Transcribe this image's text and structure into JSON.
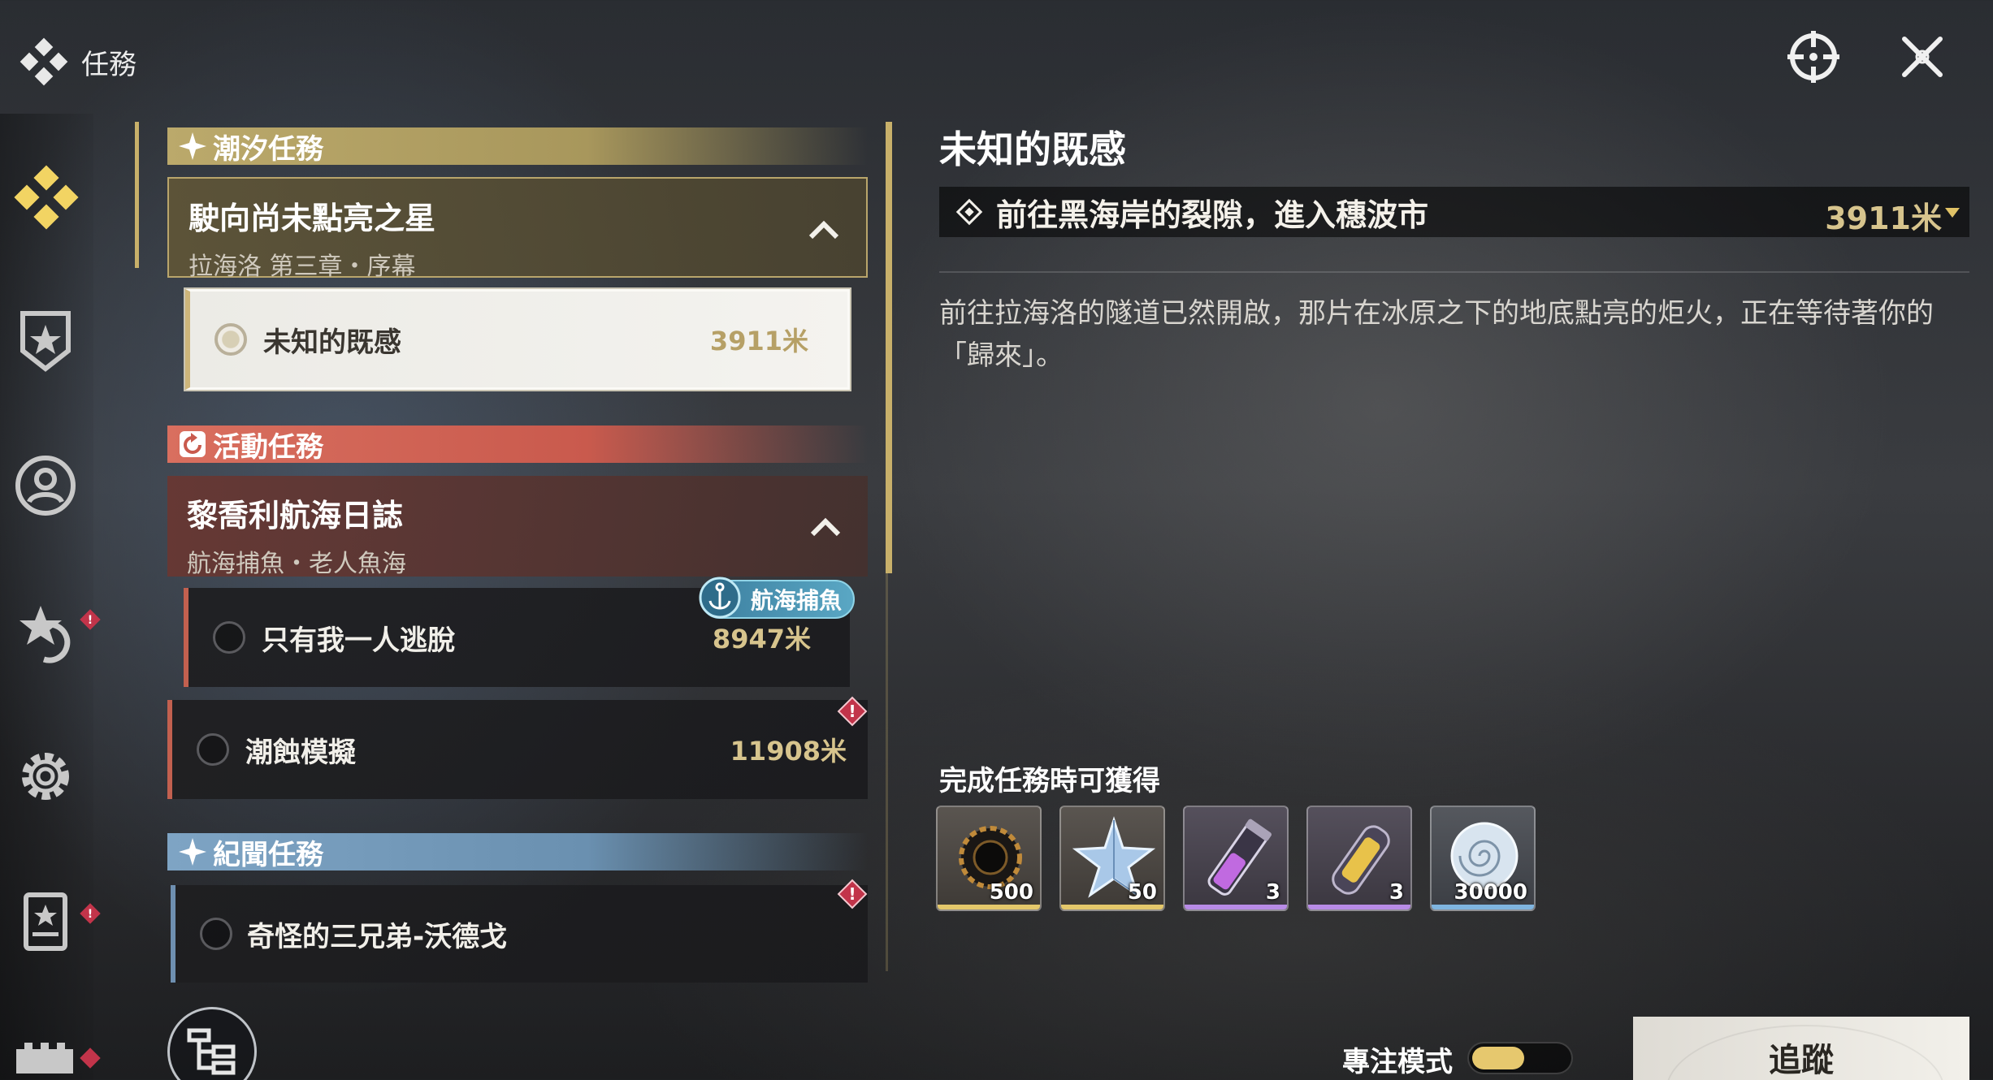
{
  "header": {
    "title": "任務"
  },
  "sidebar": {
    "items": [
      {
        "name": "quests",
        "icon": "quest-diamond-icon",
        "active": true
      },
      {
        "name": "achievements",
        "icon": "shield-star-icon"
      },
      {
        "name": "characters",
        "icon": "person-circle-icon"
      },
      {
        "name": "events",
        "icon": "star-refresh-icon",
        "alert": true
      },
      {
        "name": "settings",
        "icon": "gear-icon"
      },
      {
        "name": "tasks",
        "icon": "star-book-icon",
        "alert": true
      },
      {
        "name": "more",
        "icon": "castle-icon",
        "alert": true
      }
    ]
  },
  "quest_list": {
    "sections": [
      {
        "label": "潮汐任務",
        "color": "#bba96b",
        "chapter": {
          "title": "駛向尚未點亮之星",
          "subtitle": "拉海洛 第三章・序幕"
        },
        "quests": [
          {
            "name": "未知的既感",
            "distance": "3911米",
            "selected": true
          }
        ]
      },
      {
        "label": "活動任務",
        "color": "#d96f5f",
        "chapter": {
          "title": "黎喬利航海日誌",
          "subtitle": "航海捕魚・老人魚海"
        },
        "quests": [
          {
            "name": "只有我一人逃脫",
            "distance": "8947米",
            "tag": "航海捕魚"
          },
          {
            "name": "潮蝕模擬",
            "distance": "11908米",
            "alert": true
          }
        ]
      },
      {
        "label": "紀聞任務",
        "color": "#7ea4c4",
        "quests": [
          {
            "name": "奇怪的三兄弟-沃德戈",
            "alert": true
          }
        ]
      }
    ]
  },
  "detail": {
    "title": "未知的既感",
    "objective": "前往黑海岸的裂隙，進入穗波市",
    "objective_distance": "3911米",
    "description": "前往拉海洛的隧道已然開啟，那片在冰原之下的地底點亮的炬火，正在等待著你的「歸來」。",
    "rewards_title": "完成任務時可獲得",
    "rewards": [
      {
        "icon": "black-gear-coin-icon",
        "qty": "500",
        "rarity": "gold"
      },
      {
        "icon": "crystal-star-icon",
        "qty": "50",
        "rarity": "gold"
      },
      {
        "icon": "purple-vial-icon",
        "qty": "3",
        "rarity": "purple"
      },
      {
        "icon": "gold-capsule-icon",
        "qty": "3",
        "rarity": "purple"
      },
      {
        "icon": "shell-coin-icon",
        "qty": "30000",
        "rarity": "blue"
      }
    ]
  },
  "footer": {
    "focus_mode_label": "專注模式",
    "focus_mode_on": true,
    "track_button": "追蹤"
  }
}
